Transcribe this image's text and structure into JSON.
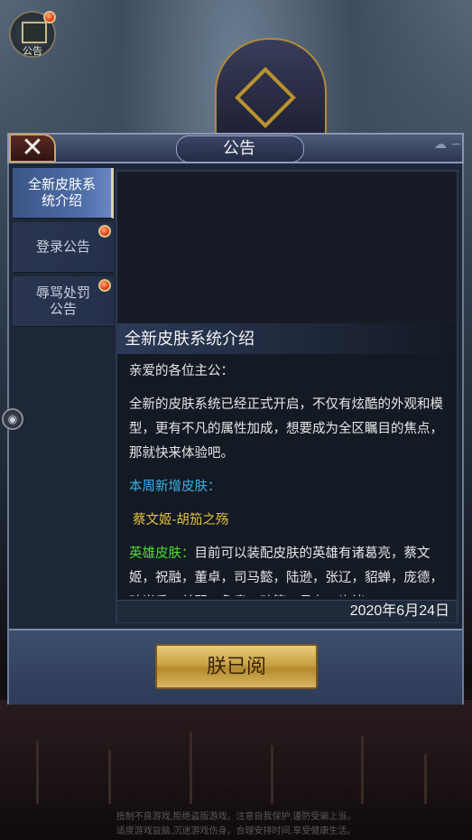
{
  "notice_button": {
    "label": "公告"
  },
  "dialog": {
    "title": "公告",
    "close_glyph": "✕"
  },
  "tabs": [
    {
      "label": "全新皮肤系统介绍",
      "active": true
    },
    {
      "label": "登录公告",
      "active": false,
      "badge": true
    },
    {
      "label": "辱骂处罚公告",
      "active": false,
      "badge": true
    }
  ],
  "article": {
    "title": "全新皮肤系统介绍",
    "greeting": "亲爱的各位主公：",
    "intro": "全新的皮肤系统已经正式开启，不仅有炫酷的外观和模型，更有不凡的属性加成，想要成为全区瞩目的焦点，那就快来体验吧。",
    "new_skins_heading": "本周新增皮肤：",
    "new_skin_name": "蔡文姬-胡笳之殇",
    "hero_skins_heading": "英雄皮肤：",
    "hero_skins_text": "目前可以装配皮肤的英雄有诸葛亮，蔡文姬，祝融，董卓，司马懿，陆逊，张辽，貂蝉，庞德，孙尚香，关羽，鲁肃，孙策，吕布，许褚",
    "date": "2020年6月24日"
  },
  "confirm_button": {
    "label": "朕已阅"
  },
  "disclaimer": {
    "line1": "抵制不良游戏,拒绝盗版游戏。注意自我保护,谨防受骗上当。",
    "line2": "适度游戏益脑,沉迷游戏伤身。合理安排时间,享受健康生活。"
  },
  "colors": {
    "accent_blue": "#3ab0e6",
    "gold": "#e2c03a",
    "green": "#4fdc2e",
    "badge_red": "#e8481c"
  }
}
